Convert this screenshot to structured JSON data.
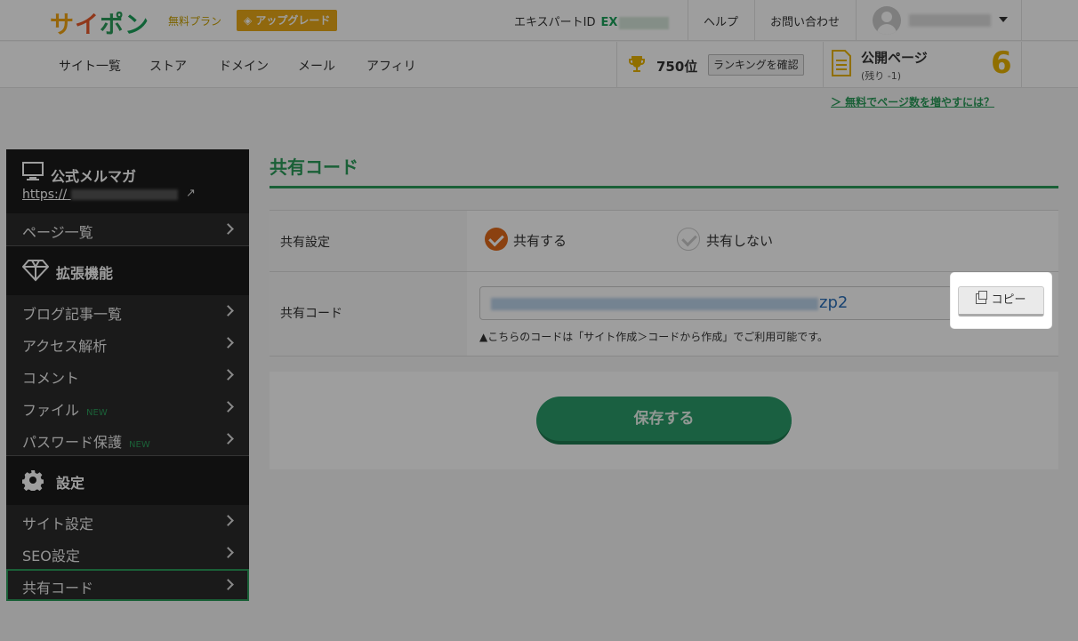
{
  "header": {
    "logo": "サイポン",
    "plan_label": "無料プラン",
    "upgrade_label": "アップグレード",
    "expert_id_label": "エキスパートID",
    "expert_id_prefix": "EX",
    "help_label": "ヘルプ",
    "contact_label": "お問い合わせ"
  },
  "nav": {
    "items": [
      "サイト一覧",
      "ストア",
      "ドメイン",
      "メール",
      "アフィリ"
    ],
    "rank": "750位",
    "rank_button": "ランキングを確認",
    "public_pages_title": "公開ページ",
    "public_pages_sub": "(残り -1)",
    "public_pages_count": "6",
    "more_link": "＞ 無料でページ数を増やすには？"
  },
  "sidebar": {
    "site_title": "公式メルマガ",
    "site_url": "https://",
    "page_list": "ページ一覧",
    "ext_title": "拡張機能",
    "ext_items": [
      "ブログ記事一覧",
      "アクセス解析",
      "コメント",
      "ファイル",
      "パスワード保護"
    ],
    "new_badge": "NEW",
    "settings_title": "設定",
    "settings_items": [
      "サイト設定",
      "SEO設定",
      "共有コード"
    ]
  },
  "main": {
    "title": "共有コード",
    "share_setting_label": "共有設定",
    "share_on": "共有する",
    "share_off": "共有しない",
    "share_code_label": "共有コード",
    "code_tail": "zp2",
    "hint": "▲こちらのコードは「サイト作成＞コードから作成」でご利用可能です。",
    "copy_label": "コピー",
    "save_label": "保存する"
  },
  "colors": {
    "brand_green": "#2a9c5a",
    "accent_orange": "#e06a1a",
    "gold": "#e8b400"
  }
}
